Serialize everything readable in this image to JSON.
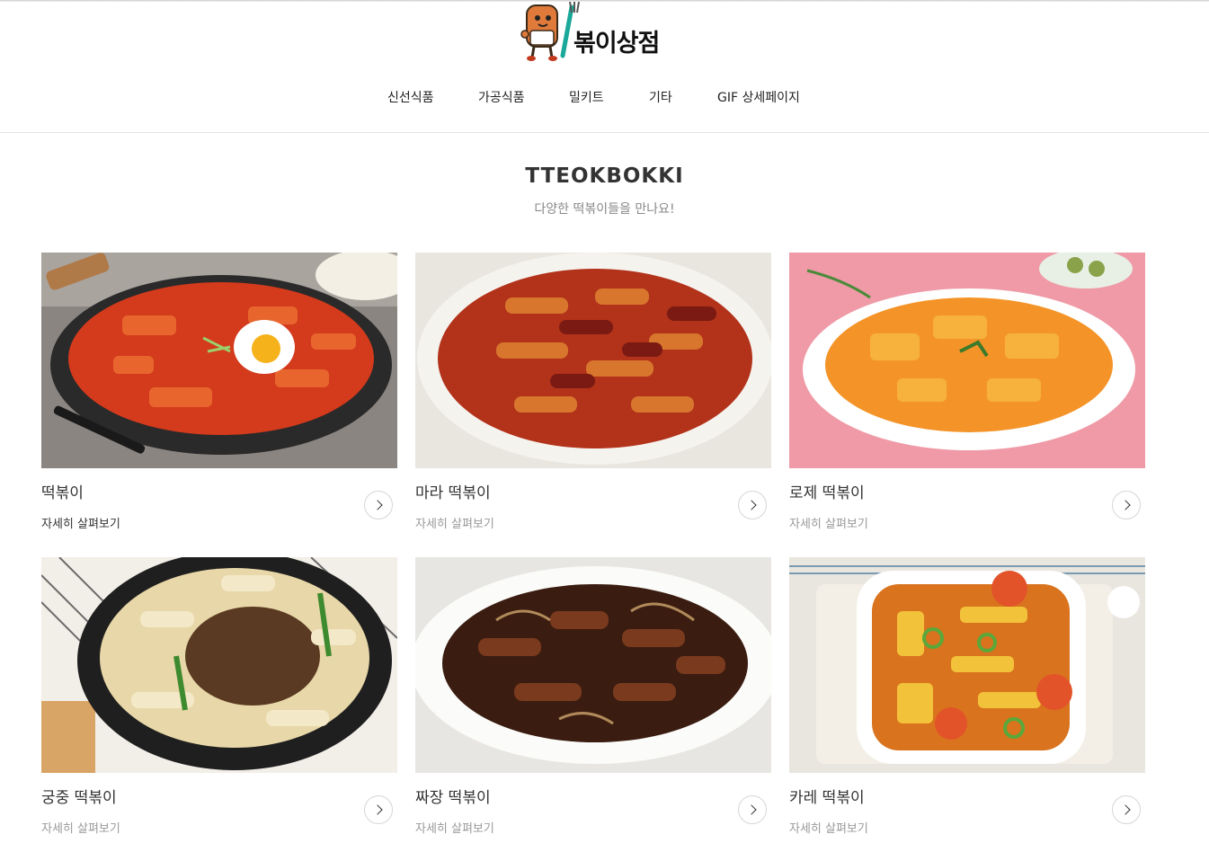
{
  "brand": {
    "name": "볶이상점"
  },
  "nav": {
    "items": [
      {
        "label": "신선식품"
      },
      {
        "label": "가공식품"
      },
      {
        "label": "밀키트"
      },
      {
        "label": "기타"
      },
      {
        "label": "GIF 상세페이지"
      }
    ]
  },
  "section": {
    "title": "TTEOKBOKKI",
    "subtitle": "다양한 떡볶이들을 만나요!"
  },
  "products": [
    {
      "name": "떡볶이",
      "link": "자세히 살펴보기"
    },
    {
      "name": "마라 떡볶이",
      "link": "자세히 살펴보기"
    },
    {
      "name": "로제 떡볶이",
      "link": "자세히 살펴보기"
    },
    {
      "name": "궁중 떡볶이",
      "link": "자세히 살펴보기"
    },
    {
      "name": "짜장 떡볶이",
      "link": "자세히 살펴보기"
    },
    {
      "name": "카레 떡볶이",
      "link": "자세히 살펴보기"
    }
  ],
  "colors": {
    "accent": "#e35b2c",
    "text": "#333333",
    "muted": "#999999"
  }
}
